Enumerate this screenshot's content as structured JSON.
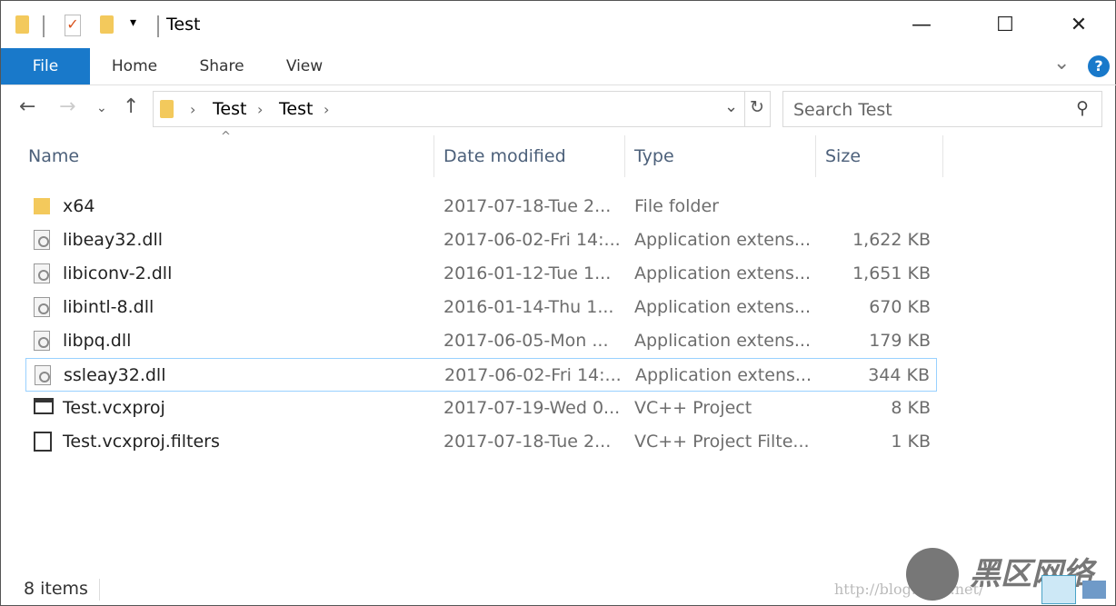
{
  "window": {
    "title": "Test",
    "minimize": "—",
    "maximize": "☐",
    "close": "✕"
  },
  "quick_access": {
    "dropdown": "▾"
  },
  "ribbon": {
    "tabs": [
      "File",
      "Home",
      "Share",
      "View"
    ],
    "expand": "⌄",
    "help": "?"
  },
  "nav": {
    "back": "←",
    "forward": "→",
    "recent": "⌄",
    "up": "↑"
  },
  "address": {
    "crumbs": [
      "Test",
      "Test"
    ],
    "sep": "›",
    "dropdown": "⌄",
    "refresh": "↻"
  },
  "search": {
    "placeholder": "Search Test",
    "icon": "⚲"
  },
  "columns": {
    "name": "Name",
    "date": "Date modified",
    "type": "Type",
    "size": "Size",
    "sort_indicator": "^"
  },
  "files": [
    {
      "name": "x64",
      "date": "2017-07-18-Tue 2...",
      "type": "File folder",
      "size": "",
      "icon": "folder"
    },
    {
      "name": "libeay32.dll",
      "date": "2017-06-02-Fri 14:...",
      "type": "Application extens...",
      "size": "1,622 KB",
      "icon": "dll"
    },
    {
      "name": "libiconv-2.dll",
      "date": "2016-01-12-Tue 1...",
      "type": "Application extens...",
      "size": "1,651 KB",
      "icon": "dll"
    },
    {
      "name": "libintl-8.dll",
      "date": "2016-01-14-Thu 1...",
      "type": "Application extens...",
      "size": "670 KB",
      "icon": "dll"
    },
    {
      "name": "libpq.dll",
      "date": "2017-06-05-Mon ...",
      "type": "Application extens...",
      "size": "179 KB",
      "icon": "dll"
    },
    {
      "name": "ssleay32.dll",
      "date": "2017-06-02-Fri 14:...",
      "type": "Application extens...",
      "size": "344 KB",
      "icon": "dll"
    },
    {
      "name": "Test.vcxproj",
      "date": "2017-07-19-Wed 0...",
      "type": "VC++ Project",
      "size": "8 KB",
      "icon": "vcxproj"
    },
    {
      "name": "Test.vcxproj.filters",
      "date": "2017-07-18-Tue 2...",
      "type": "VC++ Project Filte...",
      "size": "1 KB",
      "icon": "filters"
    }
  ],
  "status": {
    "items": "8 items"
  },
  "watermark": {
    "text": "黑区网络 www.heiqu.com",
    "url": "http://blog.csdn.net/"
  },
  "colors": {
    "accent": "#1979ca",
    "header_text": "#4c607a",
    "selection_border": "#99d1ff"
  }
}
